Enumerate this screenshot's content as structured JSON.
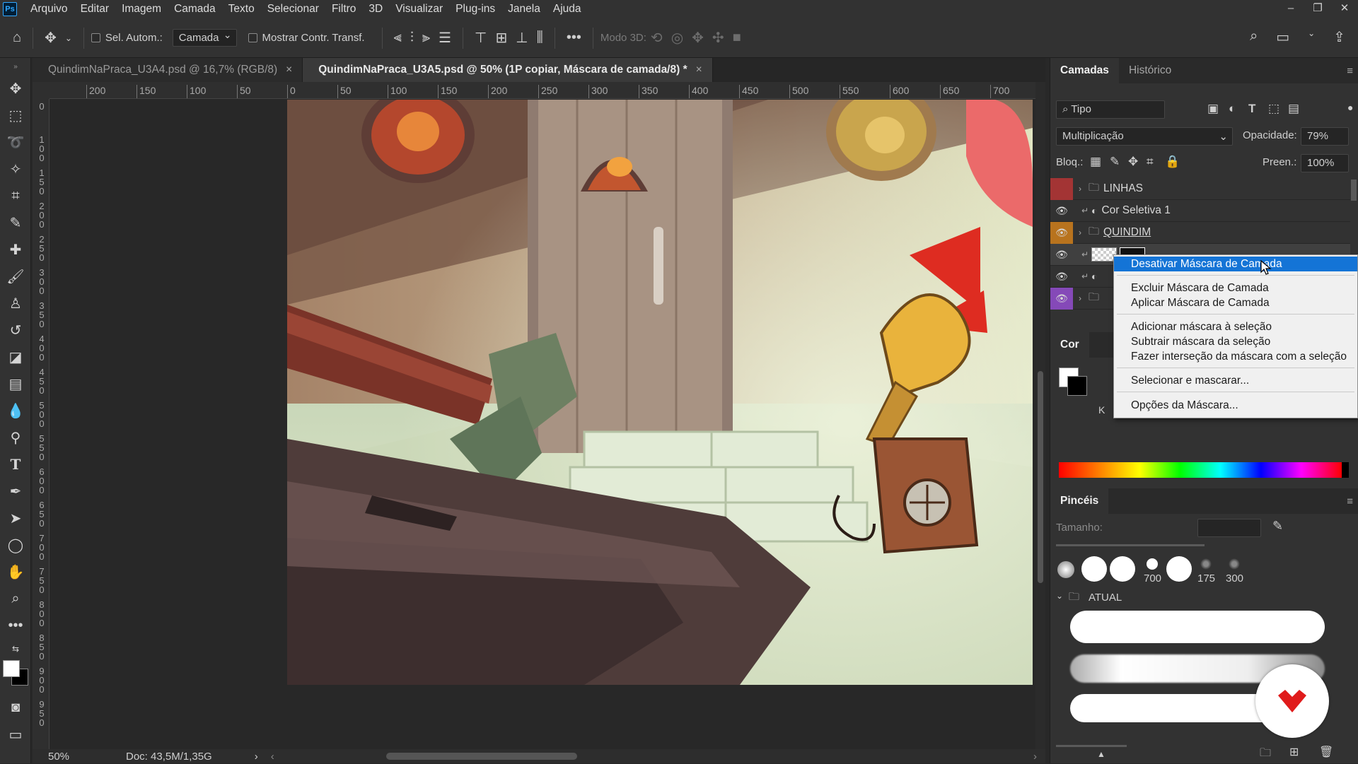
{
  "app": {
    "logo": "Ps"
  },
  "menu": [
    "Arquivo",
    "Editar",
    "Imagem",
    "Camada",
    "Texto",
    "Selecionar",
    "Filtro",
    "3D",
    "Visualizar",
    "Plug-ins",
    "Janela",
    "Ajuda"
  ],
  "window_controls": {
    "minimize": "–",
    "restore": "❐",
    "close": "✕"
  },
  "options": {
    "auto_select_label": "Sel. Autom.:",
    "auto_select_target": "Camada",
    "show_transform_label": "Mostrar Contr. Transf.",
    "mode3d_label": "Modo 3D:"
  },
  "tabs": [
    {
      "title": "QuindimNaPraca_U3A4.psd @ 16,7% (RGB/8)",
      "close": "×"
    },
    {
      "title": "QuindimNaPraca_U3A5.psd @ 50% (1P copiar, Máscara de camada/8) *",
      "close": "×"
    }
  ],
  "ruler": {
    "h": [
      "200",
      "150",
      "100",
      "50",
      "0",
      "50",
      "100",
      "150",
      "200",
      "250",
      "300",
      "350",
      "400",
      "450",
      "500",
      "550",
      "600",
      "650",
      "700"
    ],
    "v": [
      "0",
      "1 0 0",
      "1 5 0",
      "2 0 0",
      "2 5 0",
      "3 0 0",
      "3 5 0",
      "4 0 0",
      "4 5 0",
      "5 0 0",
      "5 5 0",
      "6 0 0",
      "6 5 0",
      "7 0 0",
      "7 5 0",
      "8 0 0",
      "8 5 0",
      "9 0 0",
      "9 5 0"
    ]
  },
  "status": {
    "zoom": "50%",
    "doc": "Doc: 43,5M/1,35G",
    "arrow": "›",
    "arrow_left": "‹",
    "arrow_right": "›"
  },
  "panels": {
    "layers_tab": "Camadas",
    "history_tab": "Histórico",
    "filter_kind": "Tipo",
    "blend_mode": "Multiplicação",
    "opacity_label": "Opacidade:",
    "opacity_value": "79%",
    "lock_label": "Bloq.:",
    "fill_label": "Preen.:",
    "fill_value": "100%",
    "layers": [
      {
        "name": "LINHAS",
        "type": "folder",
        "visible": false,
        "tag_color": "#a33434"
      },
      {
        "name": "Cor Seletiva 1",
        "type": "adjustment",
        "visible": true,
        "tag_color": ""
      },
      {
        "name": "QUINDIM",
        "type": "folder",
        "visible": true,
        "tag_color": "#b8731e"
      },
      {
        "name": "",
        "type": "pixel-mask",
        "visible": true,
        "tag_color": ""
      },
      {
        "name": "",
        "type": "adjustment",
        "visible": true,
        "tag_color": ""
      },
      {
        "name": "",
        "type": "folder",
        "visible": true,
        "tag_color": "#8549b8"
      }
    ],
    "color_tab": "Cor",
    "color_k_label": "K",
    "brushes_tab": "Pincéis",
    "size_label": "Tamanho:",
    "brush_presets": [
      "700",
      "175",
      "300"
    ],
    "brush_group": "ATUAL"
  },
  "context_menu": {
    "items": [
      {
        "label": "Desativar Máscara de Camada",
        "highlighted": true
      },
      {
        "label": "Excluir Máscara de Camada",
        "highlighted": false
      },
      {
        "label": "Aplicar Máscara de Camada",
        "highlighted": false
      },
      {
        "label": "Adicionar máscara à seleção",
        "highlighted": false
      },
      {
        "label": "Subtrair máscara da seleção",
        "highlighted": false
      },
      {
        "label": "Fazer interseção da máscara com a seleção",
        "highlighted": false
      },
      {
        "label": "Selecionar e mascarar...",
        "highlighted": false
      },
      {
        "label": "Opções da Máscara...",
        "highlighted": false
      }
    ]
  },
  "colors": {
    "accent": "#1474d6",
    "ps_blue": "#31a8ff",
    "ui_dark": "#323232",
    "watermark_red": "#e01b1b"
  }
}
